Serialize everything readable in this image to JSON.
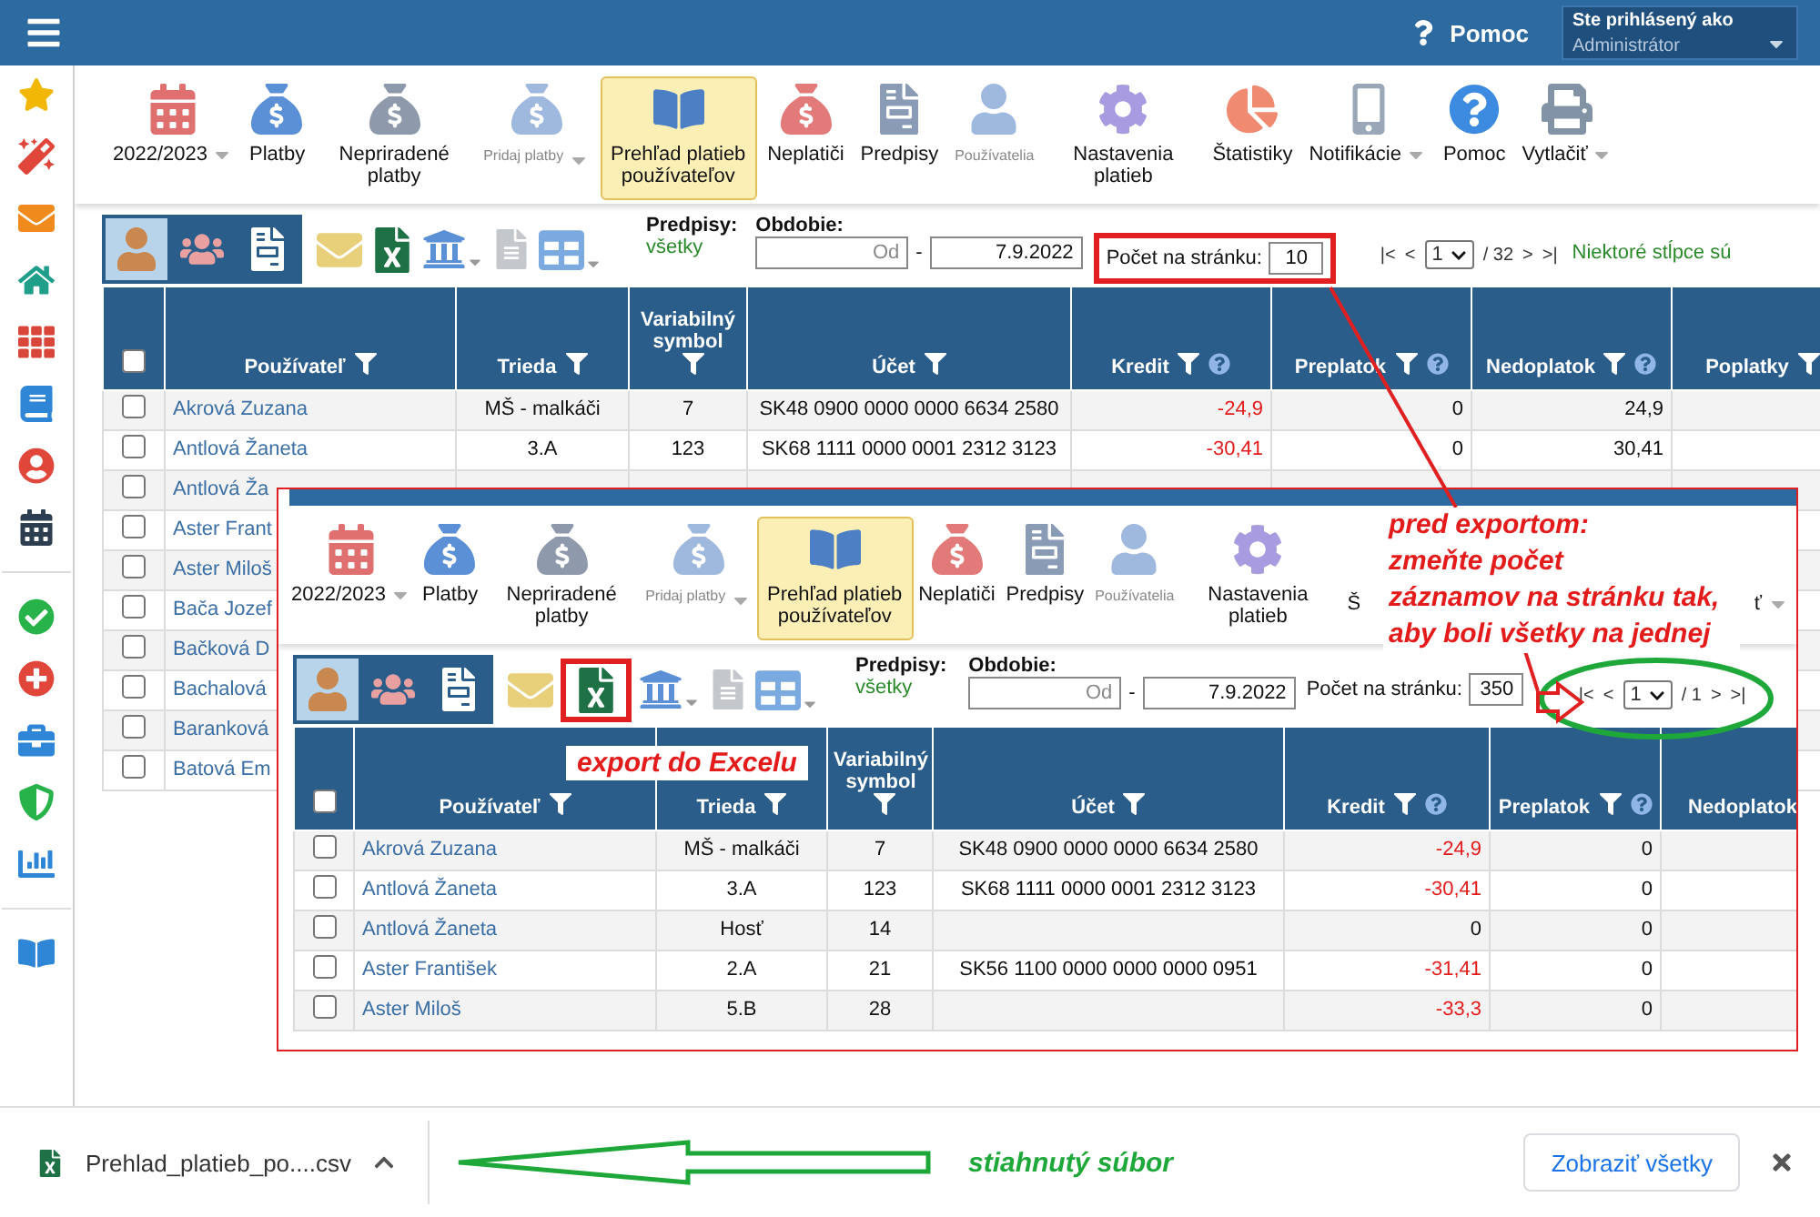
{
  "topbar": {
    "help": "Pomoc",
    "user_label": "Ste prihlásený ako",
    "user": "Administrátor"
  },
  "toolbar": [
    {
      "kind": "tool",
      "label": "2022/2023",
      "caret": true,
      "selected": false,
      "disabled": false
    },
    {
      "kind": "tool",
      "label": "Platby",
      "caret": false,
      "selected": false,
      "disabled": false
    },
    {
      "kind": "tool",
      "label": "Nepriradené platby",
      "caret": false,
      "selected": false,
      "disabled": false
    },
    {
      "kind": "tool",
      "label": "Pridaj platby",
      "caret": true,
      "selected": false,
      "disabled": true
    },
    {
      "kind": "tool",
      "label": "Prehľad platieb používateľov",
      "caret": false,
      "selected": true,
      "disabled": false
    },
    {
      "kind": "tool",
      "label": "Neplatiči",
      "caret": false,
      "selected": false,
      "disabled": false
    },
    {
      "kind": "tool",
      "label": "Predpisy",
      "caret": false,
      "selected": false,
      "disabled": false
    },
    {
      "kind": "tool",
      "label": "Používatelia",
      "caret": false,
      "selected": false,
      "disabled": true
    },
    {
      "kind": "tool",
      "label": "Nastavenia platieb",
      "caret": false,
      "selected": false,
      "disabled": false
    },
    {
      "kind": "tool",
      "label": "Štatistiky",
      "caret": false,
      "selected": false,
      "disabled": false
    },
    {
      "kind": "tool",
      "label": "Notifikácie",
      "caret": true,
      "selected": false,
      "disabled": false
    },
    {
      "kind": "tool",
      "label": "Pomoc",
      "caret": false,
      "selected": false,
      "disabled": false
    },
    {
      "kind": "tool",
      "label": "Vytlačiť",
      "caret": true,
      "selected": false,
      "disabled": false
    }
  ],
  "filters": {
    "views": [
      {
        "selected": true
      },
      {
        "selected": false
      },
      {
        "selected": false
      }
    ],
    "predpisy_label": "Predpisy:",
    "predpisy_value": "všetky",
    "period_label": "Obdobie:",
    "from_placeholder": "Od",
    "dash": "-",
    "to_value": "7.9.2022",
    "per_page_label": "Počet na stránku:",
    "per_page": "10",
    "per_page_highlighted": true,
    "excel_highlighted": false,
    "pager_circled": false,
    "pager": {
      "first": "|<",
      "prev": "<",
      "page": "1",
      "total": "/ 32",
      "next": ">",
      "last": ">|"
    },
    "columns_note": "Niektoré stĺpce sú"
  },
  "table": {
    "select_all_checked": false,
    "columns": [
      {
        "label": "Používateľ",
        "filter": true,
        "help": false
      },
      {
        "label": "Trieda",
        "filter": true,
        "help": false
      },
      {
        "label": "Variabilný symbol",
        "filter": true,
        "help": false
      },
      {
        "label": "Účet",
        "filter": true,
        "help": false
      },
      {
        "label": "Kredit",
        "filter": true,
        "help": true
      },
      {
        "label": "Preplatok",
        "filter": true,
        "help": true
      },
      {
        "label": "Nedoplatok",
        "filter": true,
        "help": true
      },
      {
        "label": "Poplatky",
        "filter": true,
        "help": false
      }
    ],
    "rows": [
      {
        "checked": false,
        "user": "Akrová Zuzana",
        "class": "MŠ - malkáči",
        "vs": "7",
        "account": "SK48 0900 0000 0000 6634 2580",
        "credit": "-24,9",
        "negative": true,
        "overpay": "0",
        "underpay": "24,9"
      },
      {
        "checked": false,
        "user": "Antlová Žaneta",
        "class": "3.A",
        "vs": "123",
        "account": "SK68 1111 0000 0001 2312 3123",
        "credit": "-30,41",
        "negative": true,
        "overpay": "0",
        "underpay": "30,41"
      },
      {
        "checked": false,
        "user": "Antlová Ža"
      },
      {
        "checked": false,
        "user": "Aster Frant"
      },
      {
        "checked": false,
        "user": "Aster Miloš"
      },
      {
        "checked": false,
        "user": "Bača Jozef"
      },
      {
        "checked": false,
        "user": "Bačková D"
      },
      {
        "checked": false,
        "user": "Bachalová"
      },
      {
        "checked": false,
        "user": "Baranková"
      },
      {
        "checked": false,
        "user": "Batová Em"
      }
    ]
  },
  "inset": {
    "toolbar": [
      {
        "kind": "tool",
        "label": "2022/2023",
        "caret": true,
        "selected": false,
        "disabled": false
      },
      {
        "kind": "tool",
        "label": "Platby",
        "caret": false,
        "selected": false,
        "disabled": false
      },
      {
        "kind": "tool",
        "label": "Nepriradené platby",
        "caret": false,
        "selected": false,
        "disabled": false
      },
      {
        "kind": "tool",
        "label": "Pridaj platby",
        "caret": true,
        "selected": false,
        "disabled": true
      },
      {
        "kind": "tool",
        "label": "Prehľad platieb používateľov",
        "caret": false,
        "selected": true,
        "disabled": false
      },
      {
        "kind": "tool",
        "label": "Neplatiči",
        "caret": false,
        "selected": false,
        "disabled": false
      },
      {
        "kind": "tool",
        "label": "Predpisy",
        "caret": false,
        "selected": false,
        "disabled": false
      },
      {
        "kind": "tool",
        "label": "Používatelia",
        "caret": false,
        "selected": false,
        "disabled": true
      },
      {
        "kind": "tool",
        "label": "Nastavenia platieb",
        "caret": false,
        "selected": false,
        "disabled": false
      },
      {
        "kind": "stub",
        "label": "Š",
        "caret": false,
        "selected": false,
        "disabled": false
      },
      {
        "kind": "stub",
        "label": "ť",
        "caret": true,
        "selected": false,
        "disabled": false
      }
    ],
    "filters": {
      "views": [
        {
          "selected": true
        },
        {
          "selected": false
        },
        {
          "selected": false
        }
      ],
      "predpisy_label": "Predpisy:",
      "predpisy_value": "všetky",
      "period_label": "Obdobie:",
      "from_placeholder": "Od",
      "dash": "-",
      "to_value": "7.9.2022",
      "per_page_label": "Počet na stránku:",
      "per_page": "350",
      "per_page_highlighted": false,
      "excel_highlighted": true,
      "pager_circled": true,
      "pager": {
        "first": "|<",
        "prev": "<",
        "page": "1",
        "total": "/ 1",
        "next": ">",
        "last": ">|"
      }
    },
    "table": {
      "select_all_checked": false,
      "columns": [
        {
          "label": "Používateľ",
          "filter": true,
          "help": false
        },
        {
          "label": "Trieda",
          "filter": true,
          "help": false
        },
        {
          "label": "Variabilný symbol",
          "filter": true,
          "help": false
        },
        {
          "label": "Účet",
          "filter": true,
          "help": false
        },
        {
          "label": "Kredit",
          "filter": true,
          "help": true
        },
        {
          "label": "Preplatok",
          "filter": true,
          "help": true
        },
        {
          "label": "Nedoplatok",
          "filter": false,
          "help": false
        }
      ],
      "rows": [
        {
          "checked": false,
          "user": "Akrová Zuzana",
          "class": "MŠ - malkáči",
          "vs": "7",
          "account": "SK48 0900 0000 0000 6634 2580",
          "credit": "-24,9",
          "negative": true,
          "overpay": "0"
        },
        {
          "checked": false,
          "user": "Antlová Žaneta",
          "class": "3.A",
          "vs": "123",
          "account": "SK68 1111 0000 0001 2312 3123",
          "credit": "-30,41",
          "negative": true,
          "overpay": "0"
        },
        {
          "checked": false,
          "user": "Antlová Žaneta",
          "class": "Hosť",
          "vs": "14",
          "credit": "0",
          "negative": false,
          "overpay": "0"
        },
        {
          "checked": false,
          "user": "Aster František",
          "class": "2.A",
          "vs": "21",
          "account": "SK56 1100 0000 0000 0000 0951",
          "credit": "-31,41",
          "negative": true,
          "overpay": "0"
        },
        {
          "checked": false,
          "user": "Aster Miloš",
          "class": "5.B",
          "vs": "28",
          "credit": "-33,3",
          "negative": true,
          "overpay": "0"
        }
      ]
    }
  },
  "annotations": {
    "export_note": [
      "pred exportom:",
      "zmeňte počet",
      "záznamov na stránku tak,",
      "aby boli všetky na jednej"
    ],
    "excel_note": "export do Excelu",
    "download_note": "stiahnutý súbor"
  },
  "download_bar": {
    "file": "Prehlad_platieb_po....csv",
    "show_all": "Zobraziť všetky"
  }
}
